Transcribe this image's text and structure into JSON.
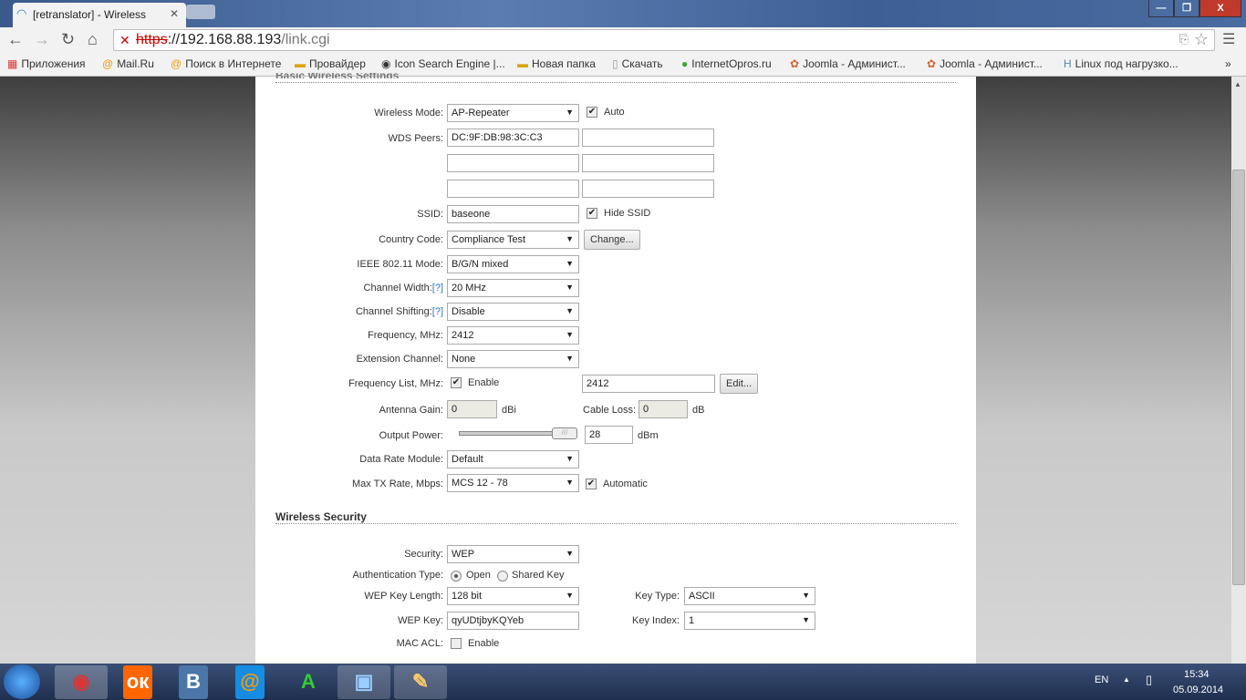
{
  "browser": {
    "tab_title": "[retranslator] - Wireless",
    "url_scheme": "https",
    "url_host": "://192.168.88.193",
    "url_path": "/link.cgi",
    "bookmarks": [
      "Приложения",
      "Mail.Ru",
      "Поиск в Интернете",
      "Провайдер",
      "Icon Search Engine |...",
      "Новая папка",
      "Скачать",
      "InternetOpros.ru",
      "Joomla - Админист...",
      "Joomla - Админист...",
      "Linux под нагрузко..."
    ],
    "more": "»"
  },
  "basic": {
    "section_title": "Basic Wireless Settings",
    "wireless_mode": {
      "label": "Wireless Mode:",
      "value": "AP-Repeater",
      "auto_label": "Auto",
      "auto": true
    },
    "wds_peers": {
      "label": "WDS Peers:",
      "values": [
        "DC:9F:DB:98:3C:C3",
        "",
        "",
        "",
        "",
        ""
      ]
    },
    "ssid": {
      "label": "SSID:",
      "value": "baseone",
      "hide_label": "Hide SSID",
      "hide": true
    },
    "country": {
      "label": "Country Code:",
      "value": "Compliance Test",
      "change_label": "Change..."
    },
    "ieee_mode": {
      "label": "IEEE 802.11 Mode:",
      "value": "B/G/N mixed"
    },
    "channel_width": {
      "label": "Channel Width:",
      "help": "[?]",
      "value": "20 MHz"
    },
    "channel_shifting": {
      "label": "Channel Shifting:",
      "help": "[?]",
      "value": "Disable"
    },
    "frequency": {
      "label": "Frequency, MHz:",
      "value": "2412"
    },
    "extension_channel": {
      "label": "Extension Channel:",
      "value": "None"
    },
    "frequency_list": {
      "label": "Frequency List, MHz:",
      "enable_label": "Enable",
      "enabled": true,
      "value": "2412",
      "edit_label": "Edit..."
    },
    "antenna_gain": {
      "label": "Antenna Gain:",
      "value": "0",
      "unit": "dBi"
    },
    "cable_loss": {
      "label": "Cable Loss:",
      "value": "0",
      "unit": "dB"
    },
    "output_power": {
      "label": "Output Power:",
      "value": "28",
      "unit": "dBm",
      "slider_fraction": 1.0
    },
    "data_rate_module": {
      "label": "Data Rate Module:",
      "value": "Default"
    },
    "max_tx_rate": {
      "label": "Max TX Rate, Mbps:",
      "value": "MCS 12 - 78",
      "auto_label": "Automatic",
      "auto": true
    }
  },
  "security": {
    "section_title": "Wireless Security",
    "security": {
      "label": "Security:",
      "value": "WEP"
    },
    "auth_type": {
      "label": "Authentication Type:",
      "options": [
        "Open",
        "Shared Key"
      ],
      "selected": "Open"
    },
    "wep_key_length": {
      "label": "WEP Key Length:",
      "value": "128 bit"
    },
    "key_type": {
      "label": "Key Type:",
      "value": "ASCII"
    },
    "wep_key": {
      "label": "WEP Key:",
      "value": "qyUDtjbyKQYeb"
    },
    "key_index": {
      "label": "Key Index:",
      "value": "1"
    },
    "mac_acl": {
      "label": "MAC ACL:",
      "enable_label": "Enable",
      "enabled": false
    }
  },
  "taskbar": {
    "lang": "EN",
    "time": "15:34",
    "date": "05.09.2014"
  }
}
